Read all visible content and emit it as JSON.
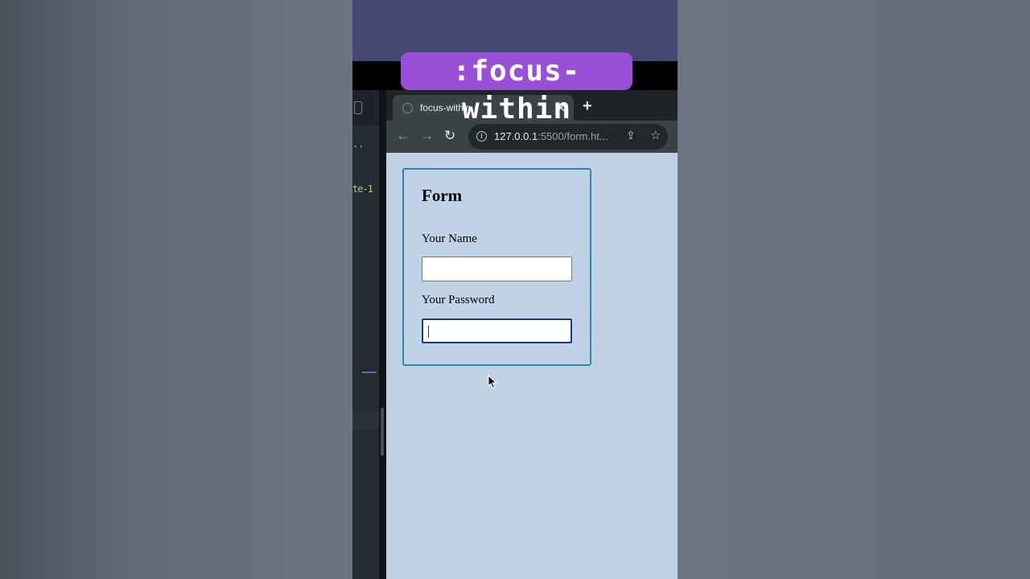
{
  "caption": ":focus-within",
  "editor": {
    "dots": "..",
    "code_fragment": "te-1"
  },
  "browser": {
    "tab": {
      "title": "focus-within",
      "close_glyph": "✕"
    },
    "new_tab_glyph": "+",
    "toolbar": {
      "back_glyph": "←",
      "forward_glyph": "→",
      "reload_glyph": "↻",
      "url_host": "127.0.0.1",
      "url_rest": ":5500/form.ht...",
      "share_glyph": "⇪",
      "star_glyph": "☆"
    }
  },
  "form": {
    "title": "Form",
    "name_label": "Your Name",
    "name_value": "",
    "password_label": "Your Password",
    "password_value": ""
  },
  "colors": {
    "caption_bg": "#9a4fd9",
    "top_band": "#434772",
    "page_bg": "#bfd2e8",
    "form_border": "#2a8aa8",
    "focus_ring": "#0f3c8a"
  }
}
